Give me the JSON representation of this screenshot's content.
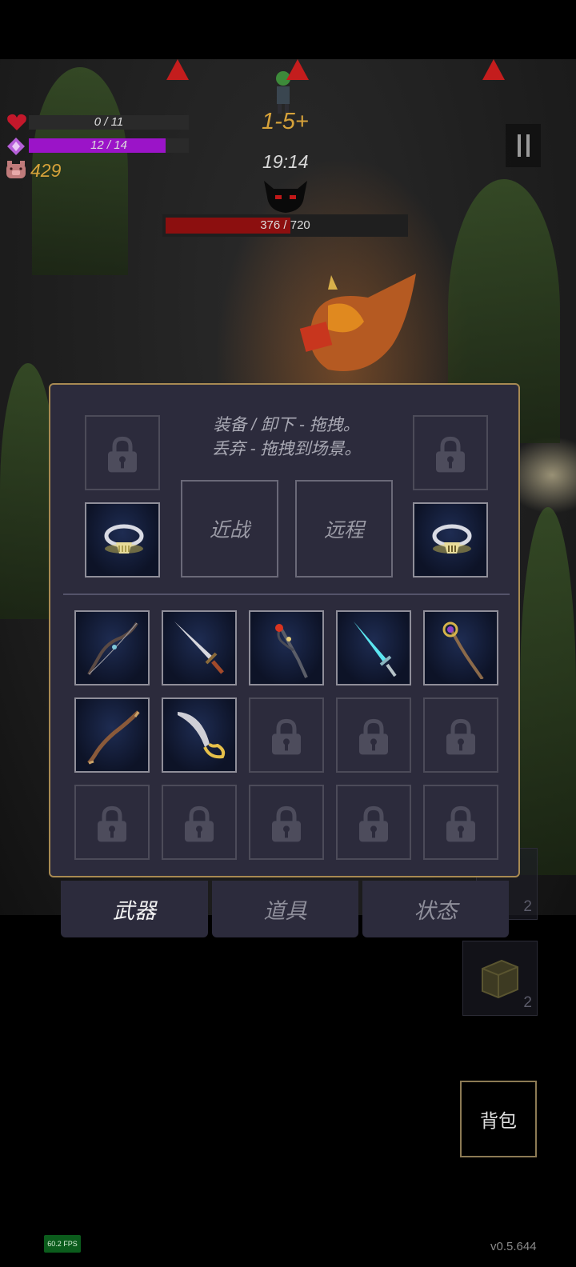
{
  "hud": {
    "health_text": "0 / 11",
    "health_fraction": 0.0,
    "mana_text": "12 / 14",
    "mana_fraction": 0.857,
    "gold": "429",
    "level": "1-5+",
    "timer": "19:14",
    "boss_hp_text": "376 / 720",
    "boss_hp_fraction": 0.522
  },
  "inventory": {
    "hint_line1": "装备 / 卸下 - 拖拽。",
    "hint_line2": "丢弃 - 拖拽到场景。",
    "melee_label": "近战",
    "ranged_label": "远程",
    "left_ring": "silver-ring-icon",
    "right_ring": "silver-ring-icon",
    "items": [
      {
        "icon": "bow-icon",
        "locked": false
      },
      {
        "icon": "sword-icon",
        "locked": false
      },
      {
        "icon": "fire-staff-icon",
        "locked": false
      },
      {
        "icon": "ice-sword-icon",
        "locked": false
      },
      {
        "icon": "gem-staff-icon",
        "locked": false
      },
      {
        "icon": "wooden-bow-icon",
        "locked": false
      },
      {
        "icon": "scimitar-icon",
        "locked": false
      },
      {
        "icon": "lock-icon",
        "locked": true
      },
      {
        "icon": "lock-icon",
        "locked": true
      },
      {
        "icon": "lock-icon",
        "locked": true
      },
      {
        "icon": "lock-icon",
        "locked": true
      },
      {
        "icon": "lock-icon",
        "locked": true
      },
      {
        "icon": "lock-icon",
        "locked": true
      },
      {
        "icon": "lock-icon",
        "locked": true
      },
      {
        "icon": "lock-icon",
        "locked": true
      }
    ]
  },
  "tabs": {
    "weapons": "武器",
    "items": "道具",
    "status": "状态"
  },
  "side": {
    "count1": "2",
    "count2": "2"
  },
  "bag_label": "背包",
  "fps": "60.2 FPS",
  "version": "v0.5.644",
  "colors": {
    "accent_gold": "#d6a23a",
    "mana": "#9b14c8",
    "health": "#c4182b",
    "boss_bar": "#8c0f0f",
    "panel_bg": "#2c2b3c",
    "panel_border": "#a88a52"
  }
}
